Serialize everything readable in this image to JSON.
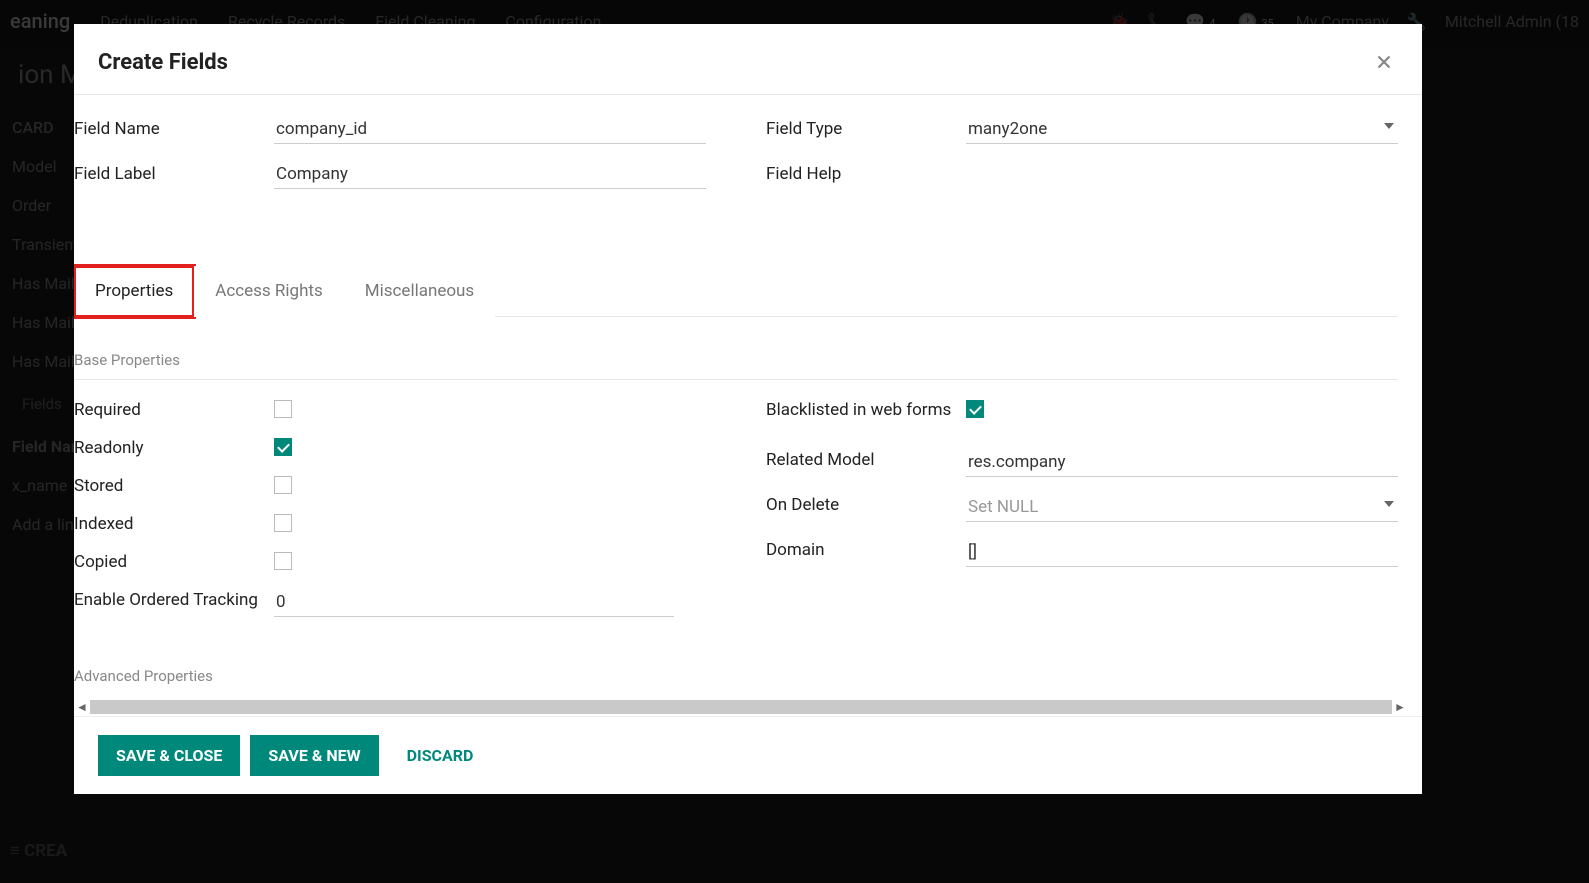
{
  "bg": {
    "app_title": "eaning",
    "menu_items": [
      "Deduplication",
      "Recycle Records",
      "Field Cleaning",
      "Configuration"
    ],
    "badge1": "4",
    "badge2": "35",
    "company": "My Company",
    "user": "Mitchell Admin (18",
    "sub_title": "ion Ma",
    "card": "CARD",
    "rows": [
      "Model",
      "Order",
      "Transient",
      "Has Mail",
      "Has Mail",
      "Has Mail"
    ],
    "fields_label": "Fields",
    "field_name_label": "Field Nar",
    "xname": "x_name",
    "add_line": "Add a lin",
    "create": "CREA"
  },
  "modal": {
    "title": "Create Fields",
    "labels": {
      "field_name": "Field Name",
      "field_label": "Field Label",
      "field_type": "Field Type",
      "field_help": "Field Help"
    },
    "values": {
      "field_name": "company_id",
      "field_label": "Company",
      "field_type": "many2one"
    },
    "tabs": [
      "Properties",
      "Access Rights",
      "Miscellaneous"
    ],
    "section1_title": "Base Properties",
    "section2_title": "Advanced Properties",
    "props_left": {
      "required": "Required",
      "readonly": "Readonly",
      "stored": "Stored",
      "indexed": "Indexed",
      "copied": "Copied",
      "tracking": "Enable Ordered Tracking",
      "tracking_val": "0"
    },
    "props_right": {
      "blacklisted": "Blacklisted in web forms",
      "related_model": "Related Model",
      "related_model_val": "res.company",
      "on_delete": "On Delete",
      "on_delete_val": "Set NULL",
      "domain": "Domain",
      "domain_val": "[]"
    },
    "footer": {
      "save_close": "SAVE & CLOSE",
      "save_new": "SAVE & NEW",
      "discard": "DISCARD"
    }
  }
}
